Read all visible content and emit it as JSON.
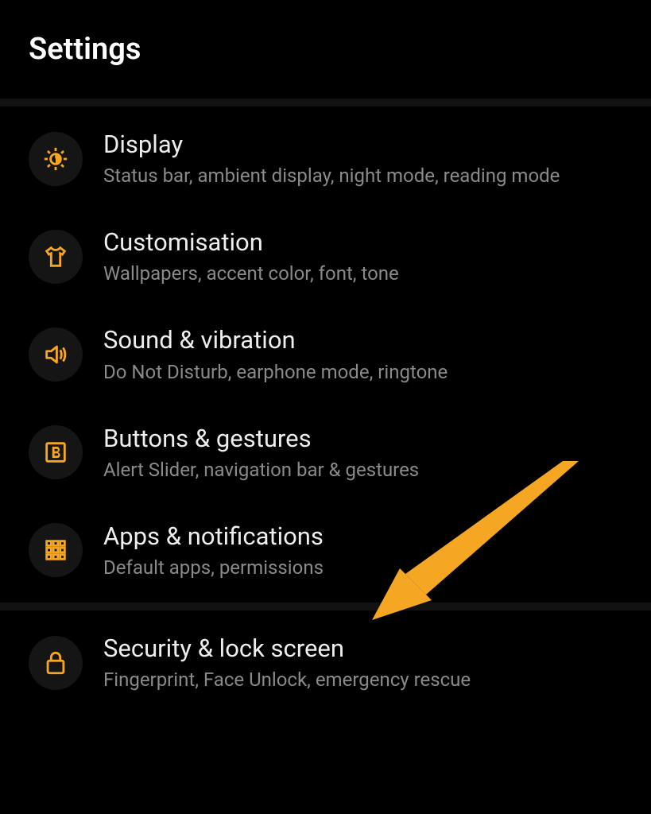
{
  "header": {
    "title": "Settings"
  },
  "items": [
    {
      "icon": "brightness",
      "title": "Display",
      "subtitle": "Status bar, ambient display, night mode, reading mode"
    },
    {
      "icon": "shirt",
      "title": "Customisation",
      "subtitle": "Wallpapers, accent color, font, tone"
    },
    {
      "icon": "speaker",
      "title": "Sound & vibration",
      "subtitle": "Do Not Disturb, earphone mode, ringtone"
    },
    {
      "icon": "box-b",
      "title": "Buttons & gestures",
      "subtitle": "Alert Slider, navigation bar & gestures"
    },
    {
      "icon": "apps-grid",
      "title": "Apps & notifications",
      "subtitle": "Default apps, permissions"
    },
    {
      "icon": "lock",
      "title": "Security & lock screen",
      "subtitle": "Fingerprint, Face Unlock, emergency rescue"
    }
  ],
  "colors": {
    "accent": "#F5A623",
    "arrow": "#F5A623"
  }
}
